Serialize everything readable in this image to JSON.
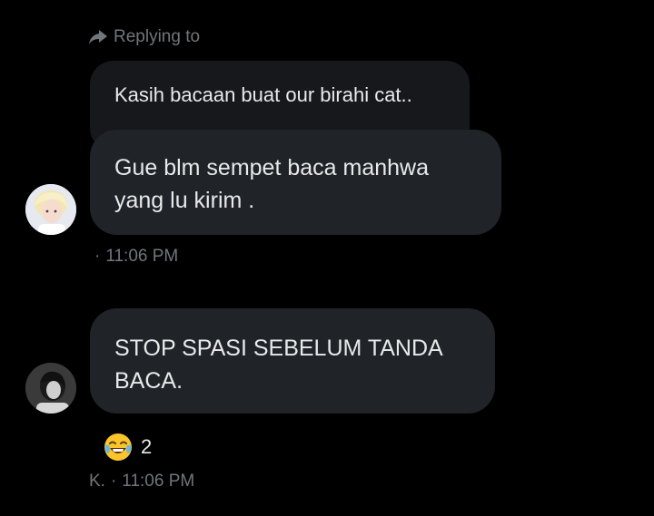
{
  "reply_header": {
    "label": "Replying to"
  },
  "quoted_message": {
    "text": "Kasih bacaan buat our birahi cat.."
  },
  "messages": [
    {
      "lines": [
        "Gue blm sempet baca manhwa",
        "yang lu kirim ."
      ],
      "sender": "",
      "separator": "·",
      "time": "11:06 PM"
    },
    {
      "lines": [
        "STOP SPASI SEBELUM TANDA",
        "BACA."
      ],
      "sender": "K.",
      "separator": "·",
      "time": "11:06 PM",
      "reaction": {
        "emoji_icon": "laughing-tears-emoji-icon",
        "count": "2"
      }
    }
  ],
  "colors": {
    "background": "#000000",
    "bubble": "#202327",
    "quoted_bubble": "#16181c",
    "text_primary": "#e7e9ea",
    "text_secondary": "#71767b"
  }
}
